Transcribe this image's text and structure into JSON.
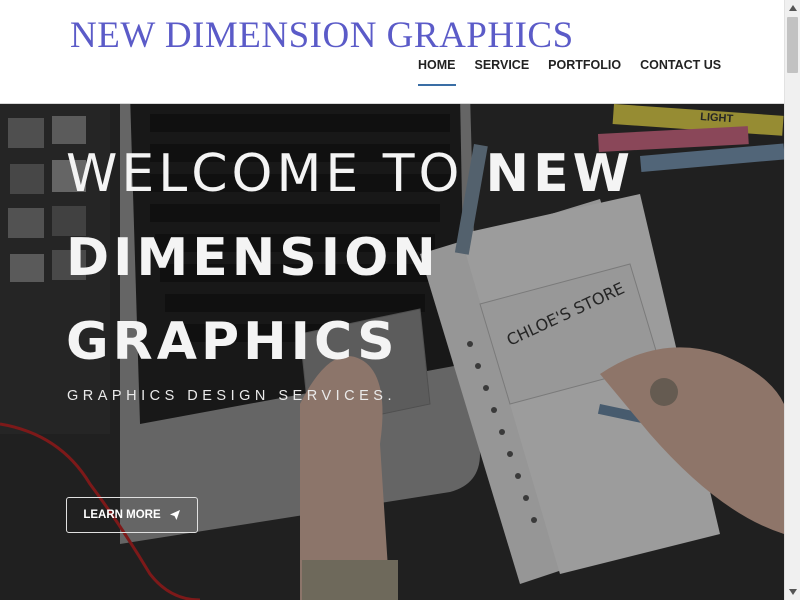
{
  "header": {
    "logo": "NEW DIMENSION GRAPHICS",
    "nav": [
      {
        "label": "HOME",
        "active": true
      },
      {
        "label": "SERVICE",
        "active": false
      },
      {
        "label": "PORTFOLIO",
        "active": false
      },
      {
        "label": "CONTACT US",
        "active": false
      }
    ]
  },
  "hero": {
    "title_light": "WELCOME TO",
    "title_bold_1": "NEW",
    "title_bold_2": "DIMENSION",
    "title_bold_3": "GRAPHICS",
    "subtitle": "GRAPHICS DESIGN SERVICES.",
    "button_label": "LEARN MORE",
    "button_icon": "paper-plane-icon",
    "sketch_text": "CHLOE'S STORE",
    "highlighter_text": "LIGHT"
  },
  "colors": {
    "logo": "#5b5bc8",
    "nav_active_underline": "#3a6ea5",
    "hero_text": "#f4f4f4"
  }
}
